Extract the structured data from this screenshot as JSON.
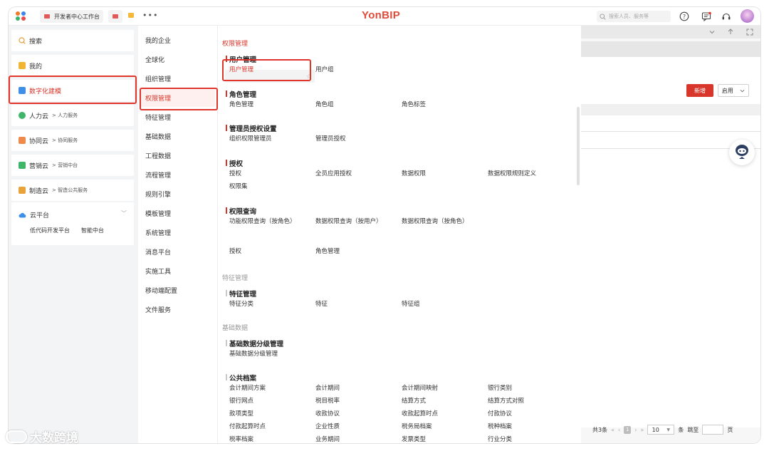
{
  "topbar": {
    "tab_label": "开发者中心工作台",
    "more": "•••",
    "brand": "YonBIP",
    "search_placeholder": "搜索人员、服务等"
  },
  "left_menu": {
    "items": [
      {
        "label": "搜索"
      },
      {
        "label": "我的"
      },
      {
        "label": "数字化建模"
      },
      {
        "label": "人力云",
        "sub": "> 人力服务"
      },
      {
        "label": "协同云",
        "sub": "> 协同服务"
      },
      {
        "label": "营销云",
        "sub": "> 营销中台"
      },
      {
        "label": "制造云",
        "sub": "> 智造公共服务"
      }
    ],
    "cloud": {
      "label": "云平台",
      "subs": [
        "低代码开发平台",
        "智能中台"
      ]
    }
  },
  "second_menu": {
    "items": [
      "我的企业",
      "全球化",
      "组织管理",
      "权限管理",
      "特征管理",
      "基础数据",
      "工程数据",
      "流程管理",
      "规则引擎",
      "模板管理",
      "系统管理",
      "消息平台",
      "实施工具",
      "移动端配置",
      "文件服务"
    ]
  },
  "content": {
    "sections": [
      {
        "title": "权限管理",
        "groups": [
          {
            "name": "用户管理",
            "items": [
              "用户管理",
              "用户组"
            ]
          },
          {
            "name": "角色管理",
            "items": [
              "角色管理",
              "角色组",
              "角色标签"
            ]
          },
          {
            "name": "管理员授权设置",
            "items": [
              "组织权限管理员",
              "管理员授权"
            ]
          },
          {
            "name": "授权",
            "items": [
              "授权",
              "全员应用授权",
              "数据权限",
              "数据权限规则定义",
              "权限集"
            ]
          },
          {
            "name": "权限查询",
            "items": [
              "功能权限查询（按角色）",
              "数据权限查询（按用户）",
              "数据权限查询（按角色）",
              "授权",
              "角色管理"
            ]
          }
        ]
      },
      {
        "title": "特征管理",
        "groups": [
          {
            "name": "特征管理",
            "items": [
              "特征分类",
              "特征",
              "特征组"
            ]
          }
        ]
      },
      {
        "title": "基础数据",
        "groups": [
          {
            "name": "基础数据分级管理",
            "items": [
              "基础数据分级管理"
            ]
          },
          {
            "name": "公共档案",
            "items": [
              "会计期间方案",
              "会计期间",
              "会计期间映射",
              "银行类别",
              "银行网点",
              "税目税率",
              "结算方式",
              "结算方式对照",
              "款项类型",
              "收款协议",
              "收款起算时点",
              "付款协议",
              "付款起算时点",
              "企业性质",
              "税务局档案",
              "税种档案",
              "税率档案",
              "业务期间",
              "发票类型",
              "行业分类"
            ]
          }
        ]
      }
    ]
  },
  "background": {
    "new_button": "新增",
    "enable_button": "启用",
    "pager": {
      "total": "共3条",
      "page": "1",
      "size": "10",
      "unit": "条",
      "jump": "跳至",
      "page_unit": "页"
    }
  },
  "watermark": "大数跨境",
  "colors": {
    "accent": "#d9362b",
    "highlight_box": "#e0352b"
  }
}
